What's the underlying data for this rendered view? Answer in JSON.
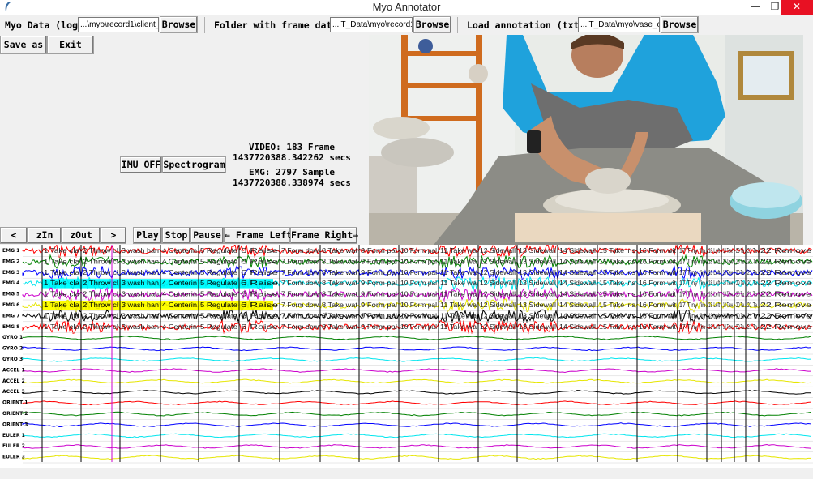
{
  "window": {
    "title": "Myo Annotator",
    "minimize": "—",
    "maximize": "❐",
    "close": "✕"
  },
  "toolbar": {
    "myo_label": "Myo Data (log)",
    "myo_path": "...\\myo\\record1\\client_",
    "browse1": "Browse",
    "folder_label": "Folder with frame data",
    "folder_path": "...iT_Data\\myo\\record1",
    "browse2": "Browse",
    "annot_label": "Load annotation (txt)",
    "annot_path": "...iT_Data\\myo\\vase_or",
    "browse3": "Browse",
    "save_as": "Save as",
    "exit": "Exit"
  },
  "controls": {
    "imu_off": "IMU OFF",
    "spectrogram": "Spectrogram",
    "video_line1": "VIDEO: 183 Frame",
    "video_line2": "1437720388.342262 secs",
    "emg_line1": "EMG: 2797 Sample",
    "emg_line2": "1437720388.338974 secs",
    "prev": "<",
    "zoom_in": "zIn",
    "zoom_out": "zOut",
    "next": ">",
    "play": "Play",
    "stop": "Stop",
    "pause": "Pause",
    "frame_left": "⇐ Frame Left",
    "frame_right": "Frame Right⇒"
  },
  "channels": [
    {
      "name": "EMG 1",
      "color": "#ff0000",
      "kind": "emg"
    },
    {
      "name": "EMG 2",
      "color": "#008000",
      "kind": "emg"
    },
    {
      "name": "EMG 3",
      "color": "#0000ff",
      "kind": "emg"
    },
    {
      "name": "EMG 4",
      "color": "#00e5ee",
      "kind": "emg"
    },
    {
      "name": "EMG 5",
      "color": "#cc00cc",
      "kind": "emg"
    },
    {
      "name": "EMG 6",
      "color": "#e6e600",
      "kind": "emg"
    },
    {
      "name": "EMG 7",
      "color": "#000000",
      "kind": "emg"
    },
    {
      "name": "EMG 8",
      "color": "#ff0000",
      "kind": "emg"
    },
    {
      "name": "GYRO 1",
      "color": "#008000",
      "kind": "imu"
    },
    {
      "name": "GYRO 2",
      "color": "#0000ff",
      "kind": "imu"
    },
    {
      "name": "GYRO 3",
      "color": "#00e5ee",
      "kind": "imu"
    },
    {
      "name": "ACCEL 1",
      "color": "#cc00cc",
      "kind": "imu"
    },
    {
      "name": "ACCEL 2",
      "color": "#e6e600",
      "kind": "imu"
    },
    {
      "name": "ACCEL 3",
      "color": "#000000",
      "kind": "imu"
    },
    {
      "name": "ORIENT 1",
      "color": "#ff0000",
      "kind": "imu"
    },
    {
      "name": "ORIENT 2",
      "color": "#008000",
      "kind": "imu"
    },
    {
      "name": "ORIENT 3",
      "color": "#0000ff",
      "kind": "imu"
    },
    {
      "name": "EULER 1",
      "color": "#00e5ee",
      "kind": "imu"
    },
    {
      "name": "EULER 2",
      "color": "#cc00cc",
      "kind": "imu"
    },
    {
      "name": "EULER 3",
      "color": "#e6e600",
      "kind": "imu"
    }
  ],
  "annotations": [
    "1 Take cla",
    "2 Throw cl",
    "3 wash han",
    "4 Centerin",
    "5 Regulate",
    "6 Raise",
    "7 Form dow",
    "8 Take wat",
    "9 Form pal",
    "10 Form pal",
    "11 Take wa",
    "12 Sidewall",
    "13 Sidewall",
    "14 Sidewall",
    "15 Take ins",
    "16 Form wit",
    "17 Tiny fin",
    "18 Left",
    "19 Take",
    "20 Ta",
    "21 Ta",
    "22 Remove"
  ],
  "annotation_bars": {
    "emg4": "#00ffff",
    "emg6": "#ffff00"
  }
}
